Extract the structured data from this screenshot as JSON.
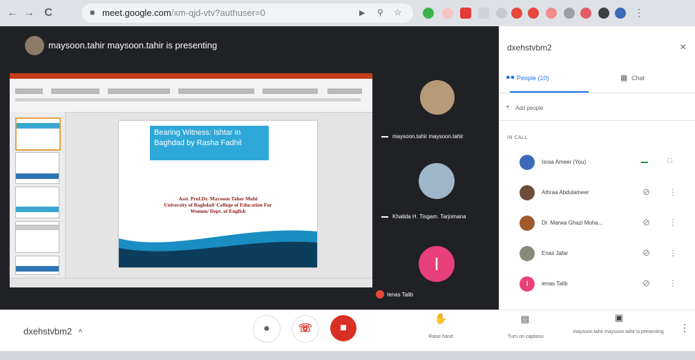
{
  "browser": {
    "url_host": "meet.google.com",
    "url_path": "/xm-qjd-vtv?authuser=0",
    "back": "←",
    "forward": "→",
    "reload": "C",
    "lock": "🔒"
  },
  "stage": {
    "presenter_label": "maysoon.tahir maysoon.tahir is presenting"
  },
  "slide": {
    "title": "Bearing Witness: Ishtar in Baghdad by Rasha Fadhil",
    "author_line1": "Asst. Prof.Dr. Maysoon Taher Muhi",
    "author_line2": "University of Baghdad/ College of Education For",
    "author_line3": "Women/ Dept. of English"
  },
  "tiles": [
    {
      "name": "maysoon.tahir maysoon.tahir"
    },
    {
      "name": "Khalida H. Tisgam. Tarjomana"
    },
    {
      "name": "Ienas Talib",
      "initial": "I"
    }
  ],
  "panel": {
    "meeting_code": "dxehstvbm2",
    "close": "×",
    "tab_people": "People (10)",
    "tab_chat": "Chat",
    "add_people": "Add people",
    "in_call": "IN CALL",
    "participants": [
      {
        "name": "Israa Ameer (You)",
        "color": "#3b6ab8"
      },
      {
        "name": "Athraa Abdulameer",
        "color": "#6b4d3a"
      },
      {
        "name": "Dr. Marwa Ghazi Moha...",
        "color": "#a05a2c"
      },
      {
        "name": "Enas Jafar",
        "color": "#8a8a7a"
      },
      {
        "name": "ienas Talib",
        "color": "#e8407a",
        "initial": "I"
      }
    ]
  },
  "bottom": {
    "meeting_code": "dxehstvbm2",
    "chevron": "^",
    "raise_hand": "Raise hand",
    "captions": "Turn on captions",
    "presenting": "maysoon.tahir maysoon.tahir is presenting",
    "more": "⋮"
  },
  "colors": {
    "stage_bg": "#202124",
    "end_call": "#d93025",
    "accent": "#1a73e8",
    "tile_avatar_pink": "#e8407a"
  }
}
